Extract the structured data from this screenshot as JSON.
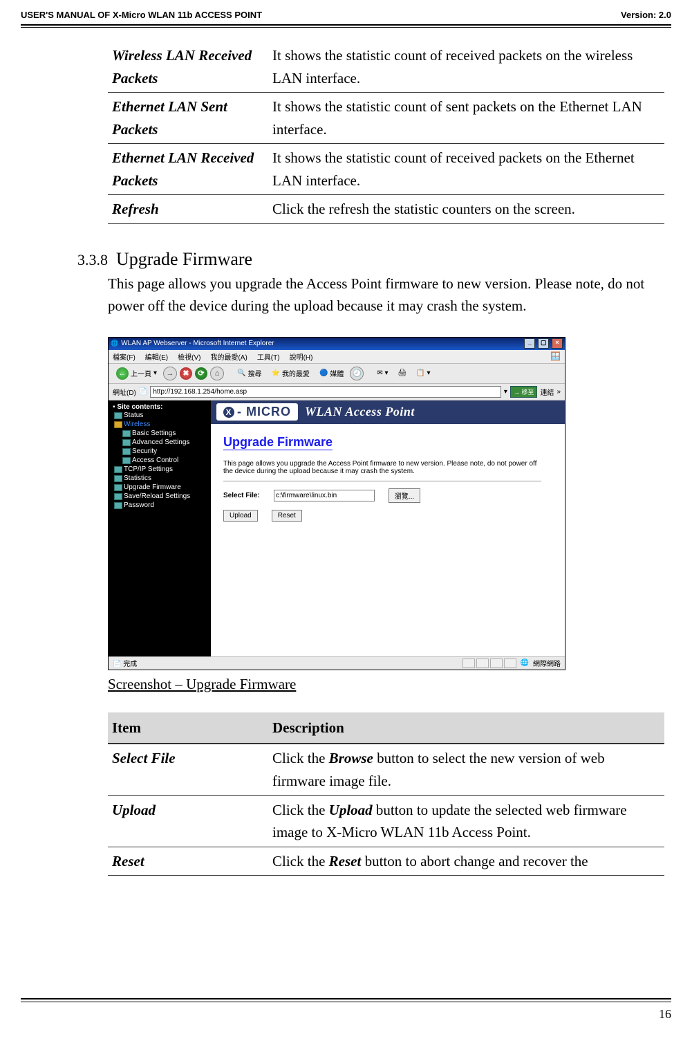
{
  "header": {
    "left": "USER'S MANUAL OF X-Micro WLAN 11b ACCESS POINT",
    "right": "Version: 2.0"
  },
  "top_table": {
    "rows": [
      {
        "term": "Wireless LAN Received Packets",
        "desc": "It shows the statistic count of received packets on the wireless LAN interface."
      },
      {
        "term": "Ethernet LAN Sent Packets",
        "desc": "It shows the statistic count of sent packets on the Ethernet LAN interface."
      },
      {
        "term": "Ethernet LAN Received Packets",
        "desc": "It shows the statistic count of received packets on the Ethernet LAN interface."
      },
      {
        "term": "Refresh",
        "desc": "Click the refresh the statistic counters on the screen."
      }
    ]
  },
  "section": {
    "number": "3.3.8",
    "title": "Upgrade Firmware",
    "body": "This page allows you upgrade the Access Point firmware to new version. Please note, do not power off the device during the upload because it may crash the system."
  },
  "screenshot": {
    "window_title": "WLAN AP Webserver - Microsoft Internet Explorer",
    "menu": {
      "file": "檔案(F)",
      "edit": "編輯(E)",
      "view": "檢視(V)",
      "fav": "我的最愛(A)",
      "tools": "工具(T)",
      "help": "說明(H)"
    },
    "toolbar": {
      "back": "上一頁",
      "search": "搜尋",
      "favorites": "我的最愛",
      "media": "媒體"
    },
    "addrbar": {
      "label": "網址(D)",
      "value": "http://192.168.1.254/home.asp",
      "go": "移至",
      "links": "連結"
    },
    "brand": {
      "logo": "- MICRO",
      "title": "WLAN Access Point"
    },
    "sidebar": {
      "header": "Site contents:",
      "items": [
        {
          "label": "Status",
          "class": ""
        },
        {
          "label": "Wireless",
          "class": "folder active"
        },
        {
          "label": "Basic Settings",
          "class": ""
        },
        {
          "label": "Advanced Settings",
          "class": ""
        },
        {
          "label": "Security",
          "class": ""
        },
        {
          "label": "Access Control",
          "class": ""
        },
        {
          "label": "TCP/IP Settings",
          "class": ""
        },
        {
          "label": "Statistics",
          "class": ""
        },
        {
          "label": "Upgrade Firmware",
          "class": ""
        },
        {
          "label": "Save/Reload Settings",
          "class": ""
        },
        {
          "label": "Password",
          "class": ""
        }
      ]
    },
    "panel": {
      "heading": "Upgrade Firmware",
      "paragraph": "This page allows you upgrade the Access Point firmware to new version. Please note, do not power off the device during the upload because it may crash the system.",
      "select_label": "Select File:",
      "file_value": "c:\\firmware\\linux.bin",
      "browse": "瀏覽...",
      "upload": "Upload",
      "reset": "Reset"
    },
    "status": {
      "done": "完成",
      "zone": "網際網路"
    }
  },
  "caption": "Screenshot – Upgrade Firmware",
  "lower_table": {
    "head": {
      "item": "Item",
      "desc": "Description"
    },
    "rows": [
      {
        "term": "Select File",
        "desc_pre": "Click the ",
        "desc_b": "Browse",
        "desc_post": " button to select the new version of web firmware image file."
      },
      {
        "term": "Upload",
        "desc_pre": "Click the ",
        "desc_b": "Upload",
        "desc_post": " button to update the selected web firmware image to X-Micro WLAN 11b Access Point."
      },
      {
        "term": "Reset",
        "desc_pre": "Click the ",
        "desc_b": "Reset",
        "desc_post": " button to abort change and recover the"
      }
    ]
  },
  "page_number": "16"
}
